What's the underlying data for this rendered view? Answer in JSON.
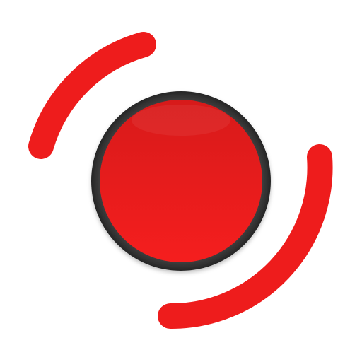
{
  "icon": {
    "name": "record-button-icon",
    "colors": {
      "arc": "#ee1c1c",
      "button_top": "#d71a1a",
      "button_bottom": "#f51e1e",
      "bezel_outer": "#262626",
      "bezel_inner": "#4a4a4a",
      "background": "#ffffff"
    }
  }
}
